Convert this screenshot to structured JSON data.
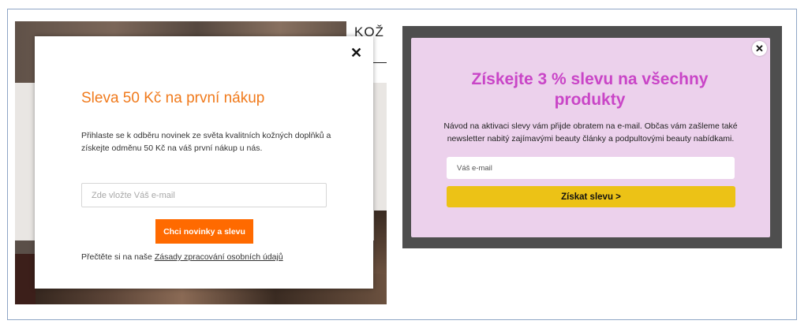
{
  "left_popup": {
    "bg_text": "KOŽ",
    "close_icon": "close-icon",
    "title": "Sleva 50 Kč na první nákup",
    "description": "Přihlaste se k odběru novinek ze světa kvalitních kožných doplňků a získejte odměnu 50 Kč na váš první nákup u nás.",
    "email_placeholder": "Zde vložte Váš e-mail",
    "submit_label": "Chci novinky a slevu",
    "privacy_prefix": "Přečtěte si na naše ",
    "privacy_link": "Zásady zpracování osobních údajů",
    "colors": {
      "accent": "#f07a1c",
      "button": "#ff6a00"
    }
  },
  "right_popup": {
    "close_icon": "close-icon",
    "title": "Získejte 3 % slevu na všechny produkty",
    "description": "Návod na aktivaci slevy vám přijde obratem na e-mail. Občas vám zašleme také newsletter nabitý zajímavými beauty články a podpultovými beauty nabídkami.",
    "email_placeholder": "Váš e-mail",
    "submit_label": "Získat slevu >",
    "colors": {
      "background": "#ecd1ec",
      "title": "#c945c7",
      "button": "#ecc216"
    }
  }
}
